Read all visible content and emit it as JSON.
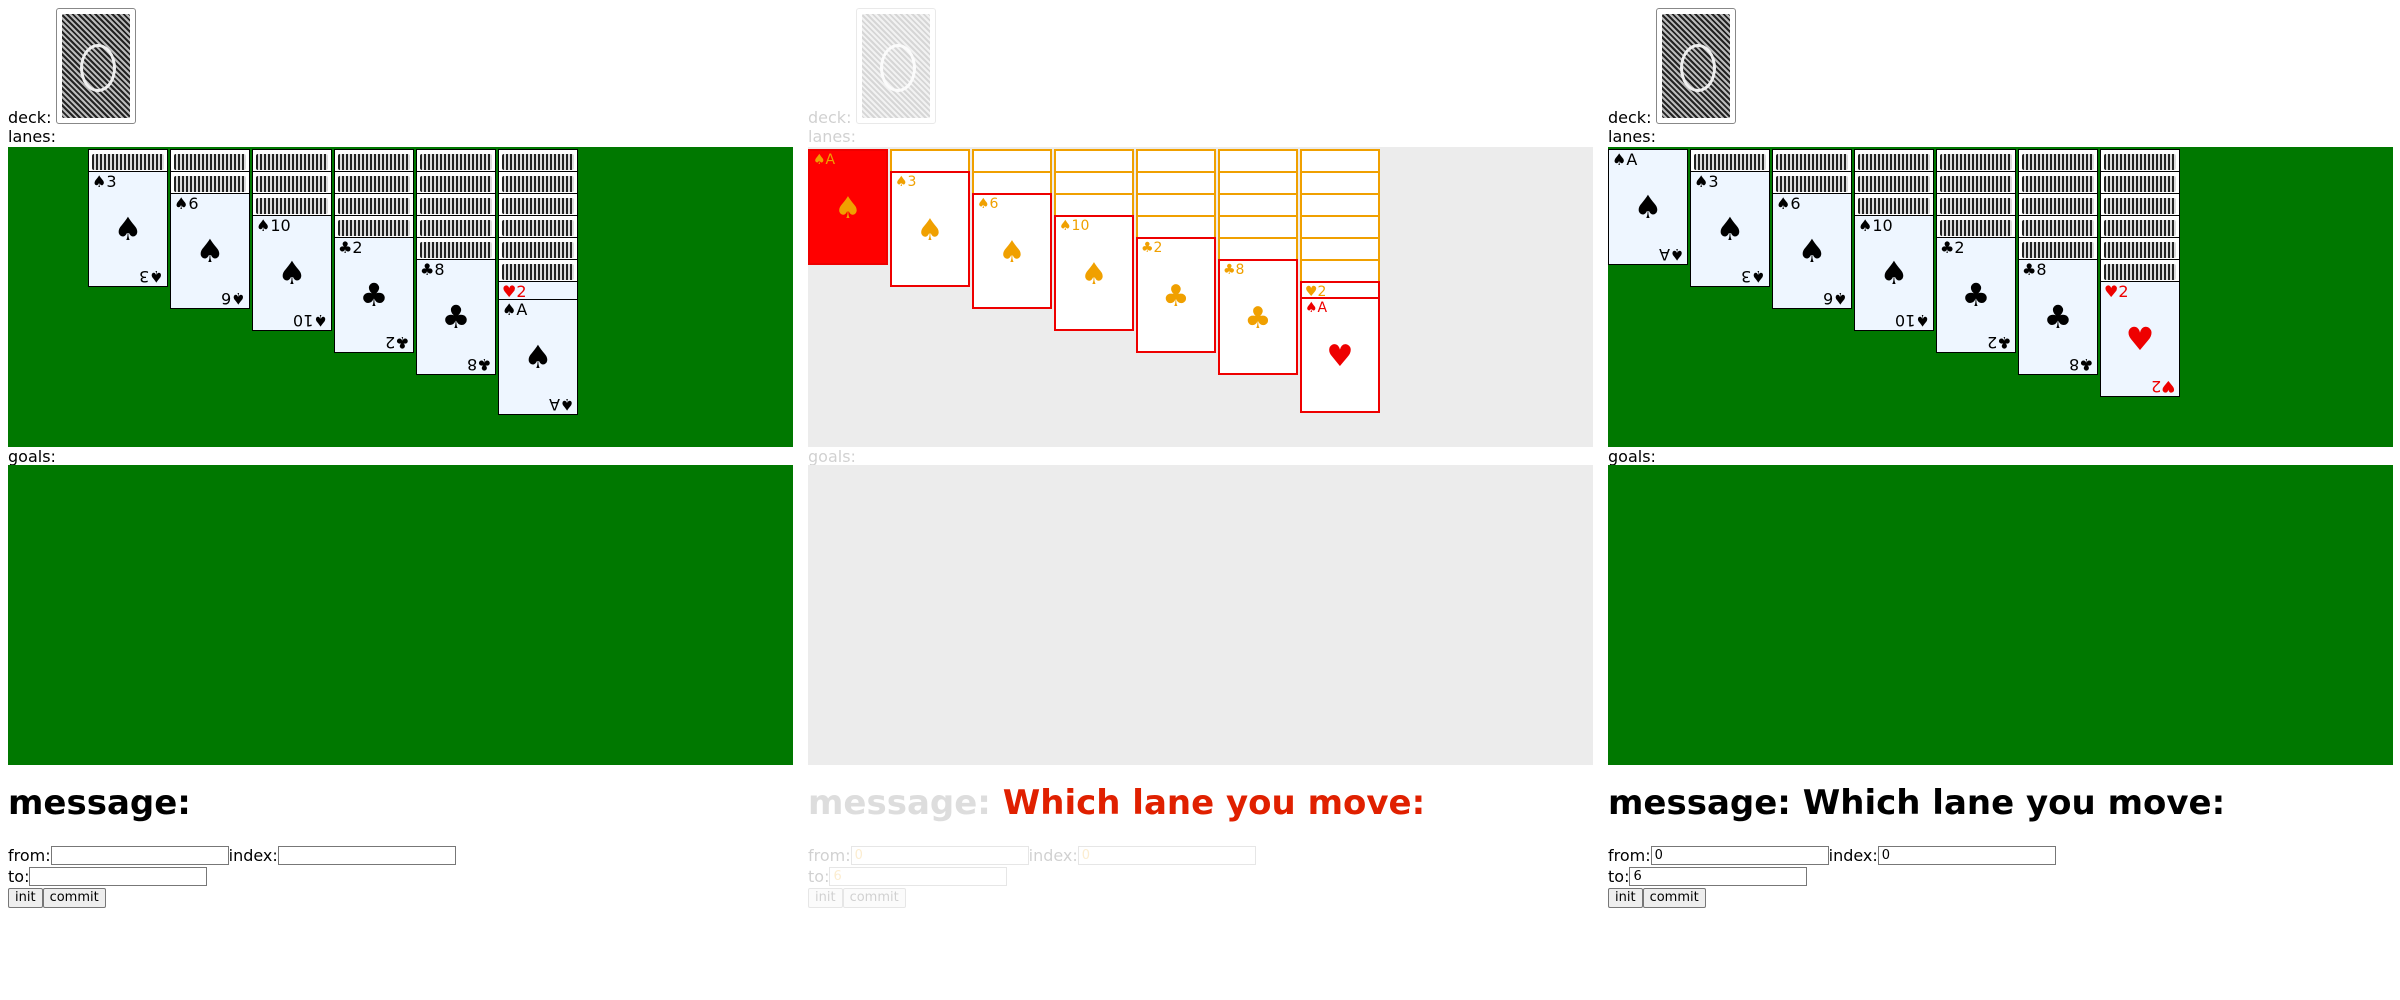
{
  "panels": [
    {
      "deck_label": "deck:",
      "lanes_label": "lanes:",
      "goals_label": "goals:",
      "message_label": "message:",
      "message_text": "",
      "from_label": "from:",
      "from_value": "",
      "index_label": "index:",
      "index_value": "",
      "to_label": "to:",
      "to_value": "",
      "init_label": "init",
      "commit_label": "commit"
    },
    {
      "deck_label": "deck:",
      "lanes_label": "lanes:",
      "goals_label": "goals:",
      "message_label": "message:",
      "message_text": "Which lane you move:",
      "from_label": "from:",
      "from_value": "0",
      "index_label": "index:",
      "index_value": "0",
      "to_label": "to:",
      "to_value": "6",
      "init_label": "init",
      "commit_label": "commit"
    },
    {
      "deck_label": "deck:",
      "lanes_label": "lanes:",
      "goals_label": "goals:",
      "message_label": "message:",
      "message_text": "Which lane you move:",
      "from_label": "from:",
      "from_value": "0",
      "index_label": "index:",
      "index_value": "0",
      "to_label": "to:",
      "to_value": "6",
      "init_label": "init",
      "commit_label": "commit"
    }
  ],
  "panel1_lanes": [
    {
      "backs": 1,
      "face": {
        "rank": "3",
        "suit": "♠",
        "color": "black"
      }
    },
    {
      "backs": 2,
      "face": {
        "rank": "6",
        "suit": "♠",
        "color": "black"
      }
    },
    {
      "backs": 3,
      "face": {
        "rank": "10",
        "suit": "♠",
        "color": "black"
      }
    },
    {
      "backs": 4,
      "face": {
        "rank": "2",
        "suit": "♣",
        "color": "black"
      }
    },
    {
      "backs": 5,
      "face": {
        "rank": "8",
        "suit": "♣",
        "color": "black"
      }
    },
    {
      "backs": 6,
      "face": {
        "rank": "2",
        "suit": "♥",
        "color": "red"
      },
      "extra": {
        "rank": "A",
        "suit": "♠",
        "color": "black"
      }
    }
  ],
  "panel3_lanes": [
    {
      "backs": 0,
      "face": {
        "rank": "A",
        "suit": "♠",
        "color": "black"
      }
    },
    {
      "backs": 1,
      "face": {
        "rank": "3",
        "suit": "♠",
        "color": "black"
      }
    },
    {
      "backs": 2,
      "face": {
        "rank": "6",
        "suit": "♠",
        "color": "black"
      }
    },
    {
      "backs": 3,
      "face": {
        "rank": "10",
        "suit": "♠",
        "color": "black"
      }
    },
    {
      "backs": 4,
      "face": {
        "rank": "2",
        "suit": "♣",
        "color": "black"
      }
    },
    {
      "backs": 5,
      "face": {
        "rank": "8",
        "suit": "♣",
        "color": "black"
      }
    },
    {
      "backs": 6,
      "face": {
        "rank": "2",
        "suit": "♥",
        "color": "red"
      }
    }
  ],
  "colors": {
    "table_green": "#007800",
    "card_face": "#eef6ff",
    "red_suit": "#e00000",
    "message_red": "#e02000"
  }
}
